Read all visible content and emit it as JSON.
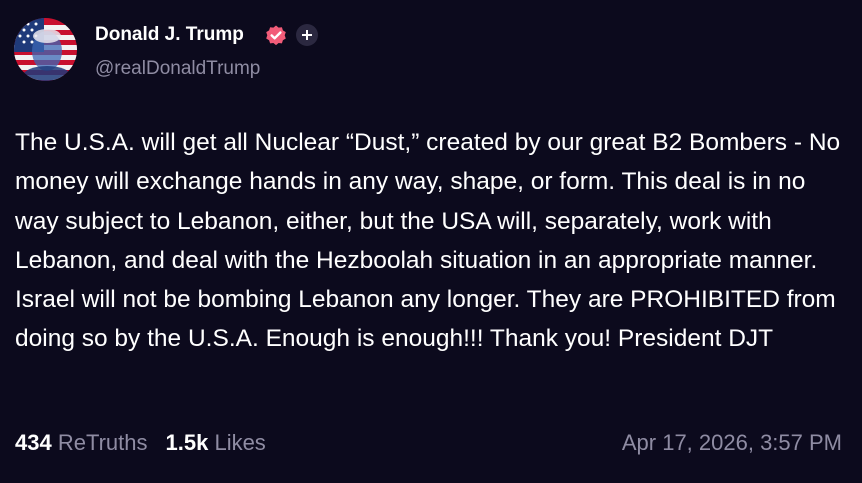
{
  "author": {
    "display_name": "Donald J. Trump",
    "handle": "@realDonaldTrump",
    "verified": true,
    "avatar_icon": "avatar-flag-portrait"
  },
  "post": {
    "text": "The U.S.A. will get all Nuclear “Dust,” created by our great B2 Bombers - No money will exchange hands in any way, shape, or form. This deal is in no way subject to Lebanon, either, but the USA will, separately, work with Lebanon, and deal with the Hezboolah situation in an appropriate manner. Israel will not be bombing Lebanon any longer. They are PROHIBITED from doing so by the U.S.A. Enough is enough!!! Thank you! President DJT",
    "retruths_count": "434",
    "retruths_label": "ReTruths",
    "likes_count": "1.5k",
    "likes_label": "Likes",
    "timestamp": "Apr 17, 2026, 3:57 PM"
  },
  "colors": {
    "background": "#0c0a1d",
    "text": "#ffffff",
    "muted": "#8f8ca3",
    "verified_badge": "#f25c79"
  }
}
